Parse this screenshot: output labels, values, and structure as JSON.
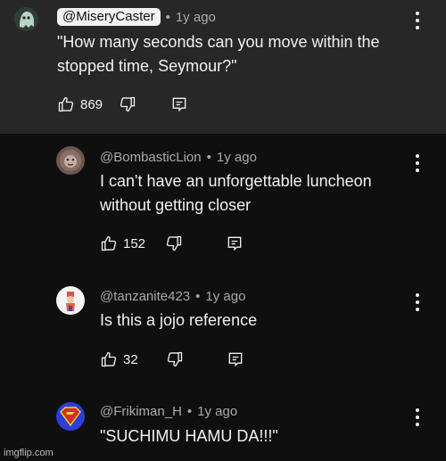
{
  "comments": [
    {
      "handle": "@MiseryCaster",
      "age": "1y ago",
      "lines": [
        "\"How many seconds can you move within the",
        "stopped time, Seymour?\""
      ],
      "likes": "869",
      "avatar_icon": "ghost-avatar-icon"
    },
    {
      "handle": "@BombasticLion",
      "age": "1y ago",
      "lines": [
        "I can't have an unforgettable luncheon",
        "without getting closer"
      ],
      "likes": "152",
      "avatar_icon": "lion-avatar-icon"
    },
    {
      "handle": "@tanzanite423",
      "age": "1y ago",
      "lines": [
        "Is this a jojo reference"
      ],
      "likes": "32",
      "avatar_icon": "character-avatar-icon"
    },
    {
      "handle": "@Frikiman_H",
      "age": "1y ago",
      "lines": [
        "\"SUCHIMU HAMU DA!!!\""
      ],
      "likes": "",
      "avatar_icon": "superman-shield-avatar-icon"
    }
  ],
  "separator": "•",
  "watermark": "imgflip.com",
  "colors": {
    "top_bg": "#272727",
    "page_bg": "#0f0f0f",
    "text": "#f1f1f1",
    "meta": "#aaaaaa"
  }
}
